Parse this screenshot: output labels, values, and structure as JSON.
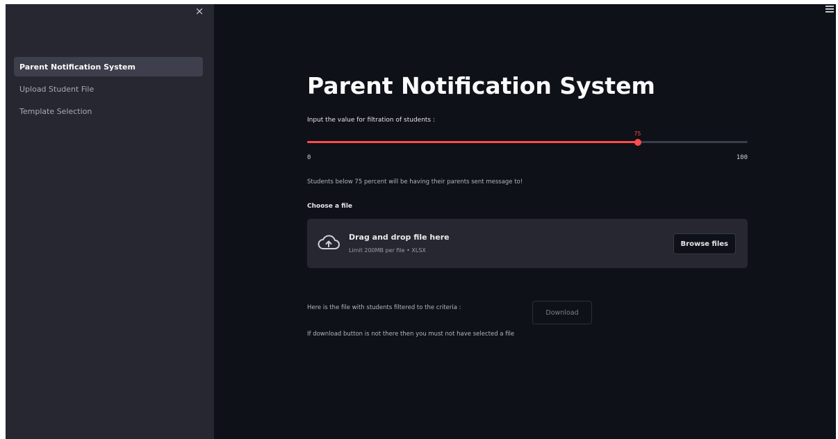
{
  "sidebar": {
    "close_glyph": "×",
    "items": [
      {
        "label": "Parent Notification System",
        "active": true
      },
      {
        "label": "Upload Student File",
        "active": false
      },
      {
        "label": "Template Selection",
        "active": false
      }
    ]
  },
  "main": {
    "menu_icon": "hamburger-icon",
    "title": "Parent Notification System",
    "slider": {
      "label": "Input the value for filtration of students :",
      "value": 75,
      "value_label": "75",
      "min": 0,
      "max": 100,
      "min_label": "0",
      "max_label": "100"
    },
    "info_text": "Students below 75 percent will be having their parents sent message to!",
    "uploader": {
      "label": "Choose a file",
      "drop_title": "Drag and drop file here",
      "drop_sub": "Limit 200MB per file • XLSX",
      "browse_label": "Browse files",
      "icon": "cloud-upload-icon"
    },
    "filtered_text": "Here is the file with students filtered to the criteria :",
    "download_label": "Download",
    "note_text": "If download button is not there then you must not have selected a file"
  },
  "colors": {
    "background": "#0e1117",
    "sidebar": "#262730",
    "accent": "#ff4b4b"
  }
}
